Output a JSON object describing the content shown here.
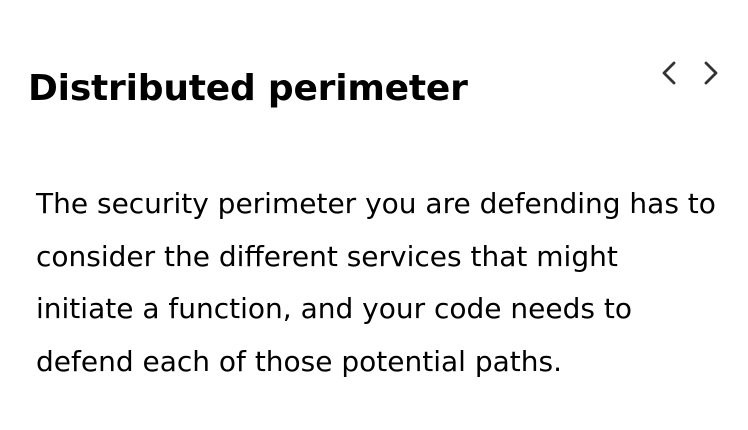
{
  "card": {
    "title": "Distributed perimeter",
    "body": "The security perimeter you are defending has to\nconsider the different services that might\ninitiate a function, and your code needs to\ndefend each of those potential paths."
  },
  "nav": {
    "previous_icon": "chevron-left-icon",
    "next_icon": "chevron-right-icon"
  },
  "colors": {
    "text": "#000000",
    "icon": "#333333",
    "background": "#ffffff"
  }
}
